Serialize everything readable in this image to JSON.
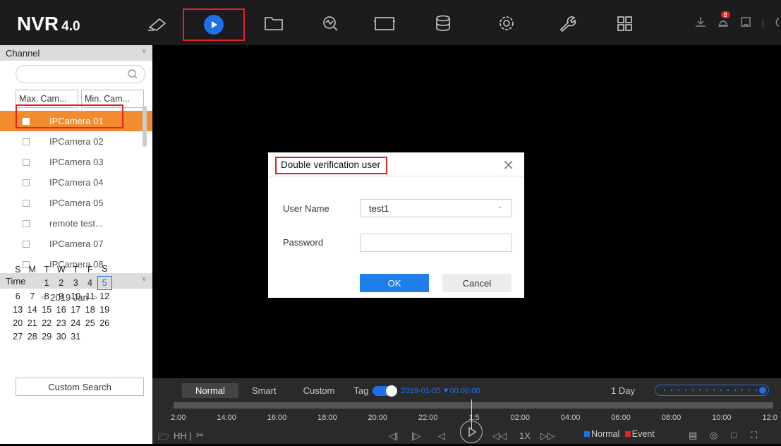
{
  "app": {
    "logo": "NVR",
    "version": "4.0"
  },
  "topnav": [
    {
      "icon": "camera-icon"
    },
    {
      "icon": "playback-icon",
      "active": true
    },
    {
      "icon": "folder-icon"
    },
    {
      "icon": "smart-search-icon"
    },
    {
      "icon": "display-icon"
    },
    {
      "icon": "storage-icon"
    },
    {
      "icon": "settings-icon"
    },
    {
      "icon": "maintenance-icon"
    },
    {
      "icon": "grid-menu-icon"
    }
  ],
  "toolbar_right": {
    "alarm_count": "8"
  },
  "sidebar": {
    "channel_header": "Channel",
    "search_placeholder": "",
    "max_cam": "Max. Cam...",
    "min_cam": "Min. Cam...",
    "channels": [
      {
        "label": "IPCamera 01",
        "selected": true
      },
      {
        "label": "IPCamera 02"
      },
      {
        "label": "IPCamera 03"
      },
      {
        "label": "IPCamera 04"
      },
      {
        "label": "IPCamera 05"
      },
      {
        "label": "remote test..."
      },
      {
        "label": "IPCamera 07"
      },
      {
        "label": "IPCamera 08"
      }
    ],
    "time_header": "Time",
    "calendar": {
      "month_label": "2019 Jan",
      "weekdays": [
        "S",
        "M",
        "T",
        "W",
        "T",
        "F",
        "S"
      ],
      "weeks": [
        [
          "",
          "",
          "1",
          "2",
          "3",
          "4",
          "5"
        ],
        [
          "6",
          "7",
          "8",
          "9",
          "10",
          "11",
          "12"
        ],
        [
          "13",
          "14",
          "15",
          "16",
          "17",
          "18",
          "19"
        ],
        [
          "20",
          "21",
          "22",
          "23",
          "24",
          "25",
          "26"
        ],
        [
          "27",
          "28",
          "29",
          "30",
          "31",
          "",
          ""
        ]
      ],
      "selected_day": "5"
    },
    "custom_search": "Custom Search"
  },
  "timeline": {
    "tabs": [
      "Normal",
      "Smart",
      "Custom"
    ],
    "tag_label": "Tag",
    "datetime": "2019-01-05",
    "time": "00:00:00",
    "range": "1 Day",
    "ticks": [
      "2:00",
      "14:00",
      "16:00",
      "18:00",
      "20:00",
      "22:00",
      "1:5",
      "02:00",
      "04:00",
      "06:00",
      "08:00",
      "10:00",
      "12:0"
    ],
    "speed": "1X",
    "legend_normal": "Normal",
    "legend_event": "Event",
    "colors": {
      "normal": "#1e6fe8",
      "event": "#e02424"
    }
  },
  "dialog": {
    "title": "Double verification user",
    "username_label": "User Name",
    "username_value": "test1",
    "password_label": "Password",
    "password_value": "",
    "ok_label": "OK",
    "cancel_label": "Cancel"
  }
}
